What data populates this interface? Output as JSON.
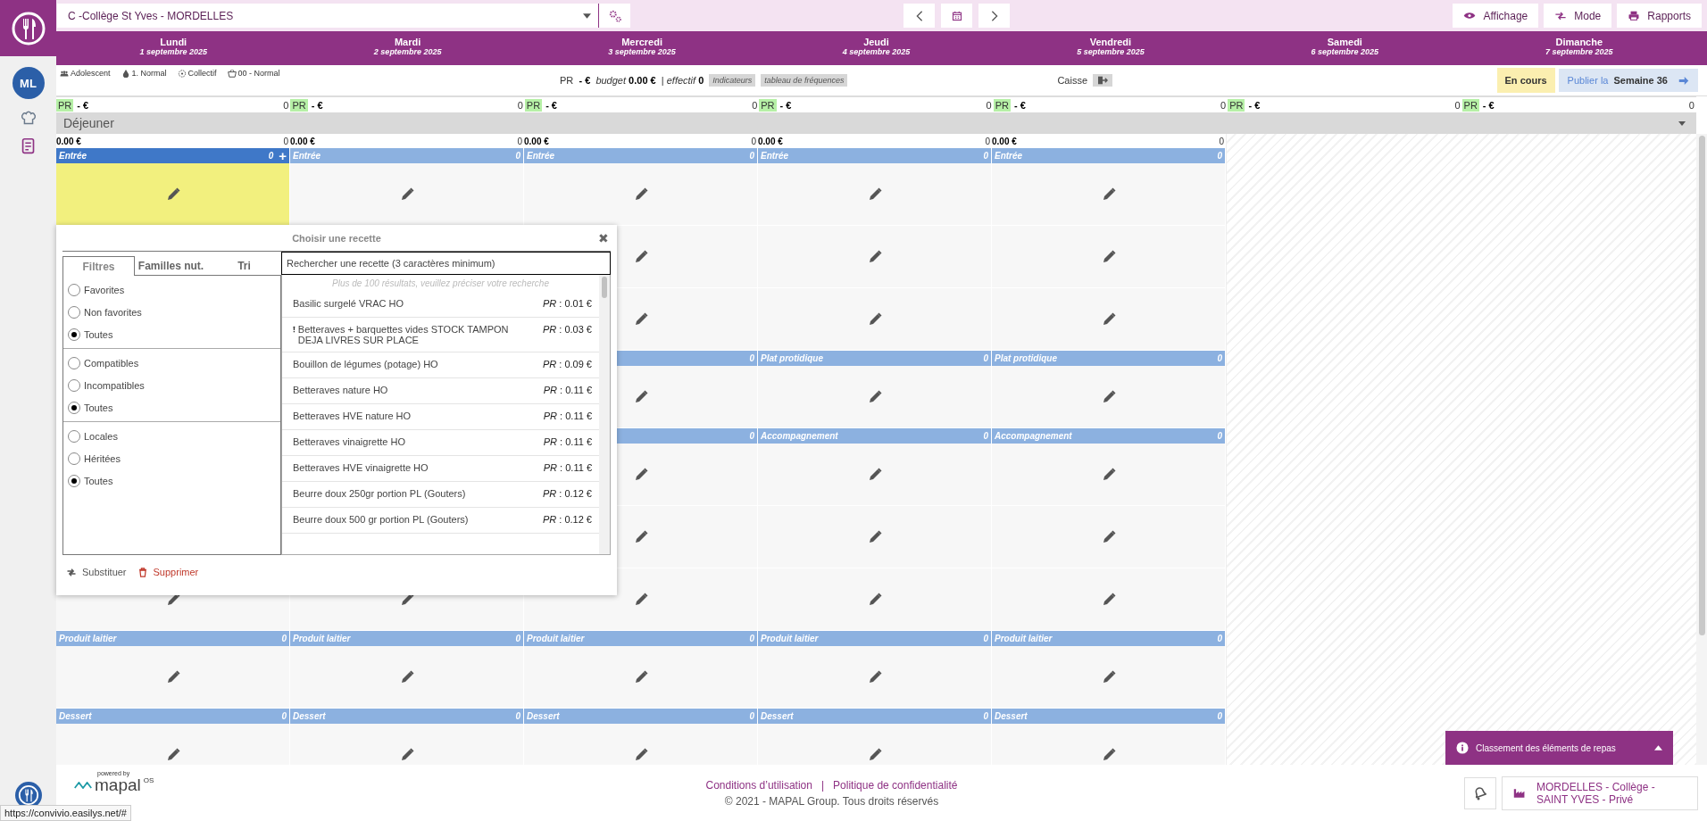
{
  "header": {
    "establishment": "C -Collège St Yves - MORDELLES",
    "buttons": [
      {
        "kind": "eye",
        "label": "Affichage"
      },
      {
        "kind": "swap",
        "label": "Mode"
      },
      {
        "kind": "printer",
        "label": "Rapports"
      }
    ]
  },
  "sidebar": {
    "user_initials": "ML",
    "items": [
      {
        "kind": "chef"
      },
      {
        "kind": "document"
      }
    ]
  },
  "days": [
    {
      "name": "Lundi",
      "date": "1 septembre 2025",
      "pr": "PR",
      "cost": "- €",
      "count": "0"
    },
    {
      "name": "Mardi",
      "date": "2 septembre 2025",
      "pr": "PR",
      "cost": "- €",
      "count": "0"
    },
    {
      "name": "Mercredi",
      "date": "3 septembre 2025",
      "pr": "PR",
      "cost": "- €",
      "count": "0"
    },
    {
      "name": "Jeudi",
      "date": "4 septembre 2025",
      "pr": "PR",
      "cost": "- €",
      "count": "0"
    },
    {
      "name": "Vendredi",
      "date": "5 septembre 2025",
      "pr": "PR",
      "cost": "- €",
      "count": "0"
    },
    {
      "name": "Samedi",
      "date": "6 septembre 2025",
      "pr": "PR",
      "cost": "- €",
      "count": "0"
    },
    {
      "name": "Dimanche",
      "date": "7 septembre 2025",
      "pr": "PR",
      "cost": "- €",
      "count": "0"
    }
  ],
  "info": {
    "tags": [
      {
        "kind": "people",
        "label": "Adolescent"
      },
      {
        "kind": "drop",
        "label": "1. Normal"
      },
      {
        "kind": "group",
        "label": "Collectif"
      },
      {
        "kind": "basket",
        "label": "00 - Normal"
      }
    ],
    "summary": "PR  **- €**  *budget* **0.00 €**  | *effectif* **0**",
    "badges": [
      "Indicateurs",
      "tableau de fréquences"
    ],
    "cash_label": "Caisse",
    "status": "En cours",
    "publish_prefix": "Publier la",
    "publish_week": "Semaine 36"
  },
  "meal": {
    "name": "Déjeuner",
    "totals": [
      {
        "amount": "0.00 €",
        "count": "0"
      },
      {
        "amount": "0.00 €",
        "count": "0"
      },
      {
        "amount": "0.00 €",
        "count": "0"
      },
      {
        "amount": "0.00 €",
        "count": "0"
      },
      {
        "amount": "0.00 €",
        "count": "0"
      }
    ],
    "courses": [
      {
        "headers": [
          {
            "label": "Entrée",
            "count": "0",
            "selected": true,
            "add": "+"
          },
          {
            "label": "Entrée",
            "count": "0",
            "selected": false
          },
          {
            "label": "Entrée",
            "count": "0",
            "selected": false
          },
          {
            "label": "Entrée",
            "count": "0",
            "selected": false
          },
          {
            "label": "Entrée",
            "count": "0",
            "selected": false
          }
        ],
        "rows": [
          [
            {
              "selected": true
            },
            {
              "selected": false
            },
            {
              "selected": false
            },
            {
              "selected": false
            },
            {
              "selected": false
            }
          ],
          [
            {},
            {},
            {
              "selected": false
            },
            {
              "selected": false
            },
            {
              "selected": false
            }
          ],
          [
            {},
            {},
            {
              "selected": false
            },
            {
              "selected": false
            },
            {
              "selected": false
            }
          ]
        ]
      },
      {
        "headers": [
          {
            "count": "0",
            "selected": false
          },
          {
            "label": "Plat protidique",
            "count": "0",
            "selected": false
          },
          {
            "label": "Plat protidique",
            "count": "0",
            "selected": false
          }
        ],
        "rows": [
          [
            {},
            {},
            {
              "selected": false
            },
            {
              "selected": false
            },
            {
              "selected": false
            }
          ]
        ]
      },
      {
        "headers": [
          {
            "count": "0",
            "selected": false
          },
          {
            "label": "Accompagnement",
            "count": "0",
            "selected": false
          },
          {
            "label": "Accompagnement",
            "count": "0",
            "selected": false
          }
        ],
        "rows": [
          [
            {},
            {},
            {
              "selected": false
            },
            {
              "selected": false
            },
            {
              "selected": false
            }
          ],
          [
            {},
            {},
            {
              "selected": false
            },
            {
              "selected": false
            },
            {
              "selected": false
            }
          ],
          [
            {
              "selected": false
            },
            {
              "selected": false
            },
            {
              "selected": false
            },
            {
              "selected": false
            },
            {
              "selected": false
            }
          ]
        ]
      },
      {
        "headers": [
          {
            "label": "Produit laitier",
            "count": "0",
            "selected": false
          },
          {
            "label": "Produit laitier",
            "count": "0",
            "selected": false
          },
          {
            "label": "Produit laitier",
            "count": "0",
            "selected": false
          },
          {
            "label": "Produit laitier",
            "count": "0",
            "selected": false
          },
          {
            "label": "Produit laitier",
            "count": "0",
            "selected": false
          }
        ],
        "rows": [
          [
            {
              "selected": false
            },
            {
              "selected": false
            },
            {
              "selected": false
            },
            {
              "selected": false
            },
            {
              "selected": false
            }
          ]
        ]
      },
      {
        "headers": [
          {
            "label": "Dessert",
            "count": "0",
            "selected": false
          },
          {
            "label": "Dessert",
            "count": "0",
            "selected": false
          },
          {
            "label": "Dessert",
            "count": "0",
            "selected": false
          },
          {
            "label": "Dessert",
            "count": "0",
            "selected": false
          },
          {
            "label": "Dessert",
            "count": "0",
            "selected": false
          }
        ],
        "rows": [
          [
            {
              "selected": false
            },
            {
              "selected": false
            },
            {
              "selected": false
            },
            {
              "selected": false
            },
            {
              "selected": false
            }
          ]
        ]
      }
    ]
  },
  "recipe_picker": {
    "title": "Choisir une recette",
    "close": "✖",
    "tabs": [
      {
        "label": "Filtres",
        "selected": true
      },
      {
        "label": "Familles nut.",
        "selected": false
      },
      {
        "label": "Tri",
        "selected": false
      }
    ],
    "filter_groups": [
      [
        {
          "label": "Favorites",
          "selected": false
        },
        {
          "label": "Non favorites",
          "selected": false
        },
        {
          "label": "Toutes",
          "selected": true
        }
      ],
      [
        {
          "label": "Compatibles",
          "selected": false
        },
        {
          "label": "Incompatibles",
          "selected": false
        },
        {
          "label": "Toutes",
          "selected": true
        }
      ],
      [
        {
          "label": "Locales",
          "selected": false
        },
        {
          "label": "Héritées",
          "selected": false
        },
        {
          "label": "Toutes",
          "selected": true
        }
      ]
    ],
    "search_placeholder": "Rechercher une recette (3 caractères minimum)",
    "notice": "Plus de 100 résultats, veuillez préciser votre recherche",
    "results": [
      {
        "name": "Basilic surgelé VRAC HO",
        "price": "*PR* : 0.01 €",
        "warning": false
      },
      {
        "name": "Betteraves + barquettes vides STOCK TAMPON DEJA LIVRES SUR PLACE",
        "price": "*PR* : 0.03 €",
        "warning": true
      },
      {
        "name": "Bouillon de légumes (potage) HO",
        "price": "*PR* : 0.09 €",
        "warning": false
      },
      {
        "name": "Betteraves nature HO",
        "price": "*PR* : 0.11 €",
        "warning": false
      },
      {
        "name": "Betteraves HVE nature HO",
        "price": "*PR* : 0.11 €",
        "warning": false
      },
      {
        "name": "Betteraves vinaigrette HO",
        "price": "*PR* : 0.11 €",
        "warning": false
      },
      {
        "name": "Betteraves HVE vinaigrette HO",
        "price": "*PR* : 0.11 €",
        "warning": false
      },
      {
        "name": "Beurre doux 250gr portion PL (Gouters)",
        "price": "*PR* : 0.12 €",
        "warning": false
      },
      {
        "name": "Beurre doux 500 gr portion PL (Gouters)",
        "price": "*PR* : 0.12 €",
        "warning": false
      }
    ],
    "actions": [
      {
        "kind": "substitute",
        "label": "Substituer"
      },
      {
        "kind": "delete",
        "label": "Supprimer"
      }
    ]
  },
  "ranking_panel": {
    "label": "Classement des éléments de repas"
  },
  "footer": {
    "powered_by": "powered by",
    "brand": "mapal",
    "brand_suffix": "OS",
    "links": [
      "Conditions d’utilisation",
      "Politique de confidentialité"
    ],
    "separator": "|",
    "copyright": "© 2021 - MAPAL Group. Tous droits réservés",
    "site": "MORDELLES - Collège - SAINT YVES - Privé"
  },
  "status_url": "https://convivio.easilys.net/#"
}
